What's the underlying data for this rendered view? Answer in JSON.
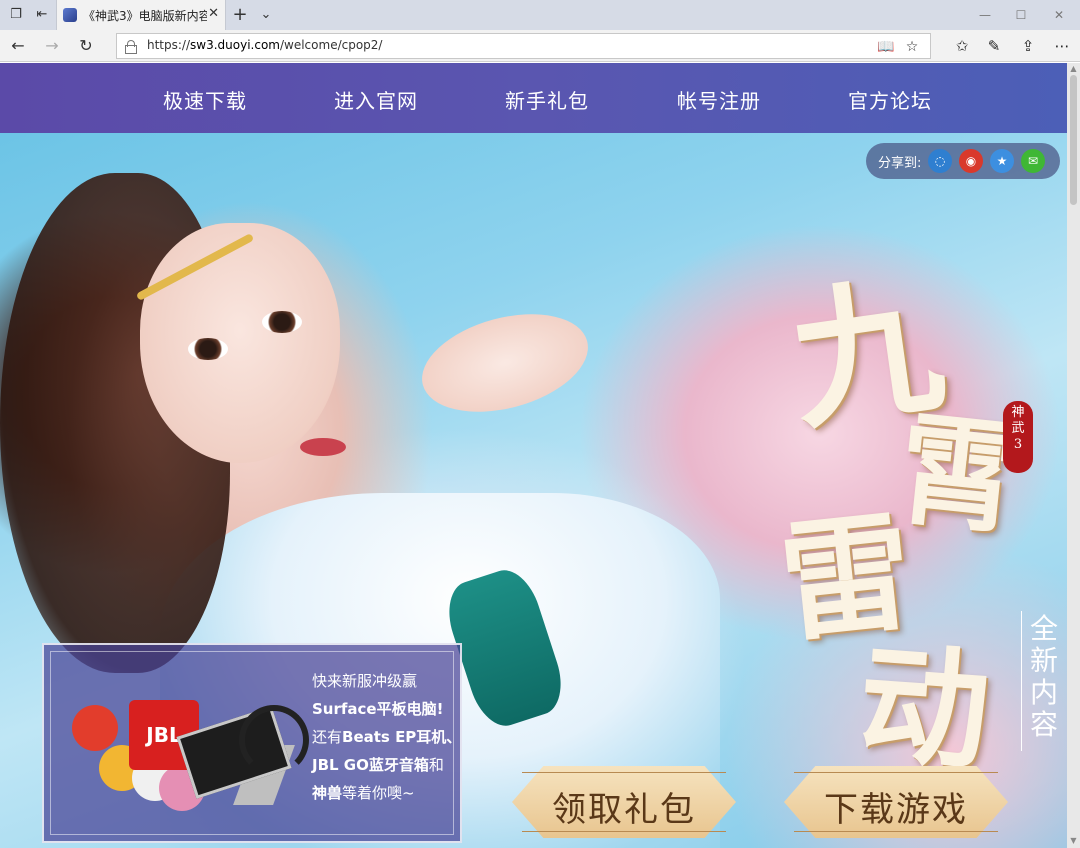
{
  "browser": {
    "tab_title": "《神武3》电脑版新内容",
    "url_prefix": "https://",
    "url_domain": "sw3.duoyi.com",
    "url_path": "/welcome/cpop2/"
  },
  "nav": {
    "items": [
      {
        "label": "极速下载"
      },
      {
        "label": "进入官网"
      },
      {
        "label": "新手礼包"
      },
      {
        "label": "帐号注册"
      },
      {
        "label": "官方论坛"
      }
    ]
  },
  "share": {
    "label": "分享到:",
    "targets": [
      {
        "icon": "qq-zone-icon",
        "color": "#2f7fd0"
      },
      {
        "icon": "weibo-icon",
        "color": "#d9392b"
      },
      {
        "icon": "favorite-star-icon",
        "color": "#3d8fe0"
      },
      {
        "icon": "wechat-icon",
        "color": "#3fb735"
      }
    ]
  },
  "hero": {
    "title_chars": [
      "九",
      "霄",
      "雷",
      "动"
    ],
    "seal_text": "神武3",
    "subtitle": "全新内容"
  },
  "promo": {
    "line1": "快来新服冲级赢",
    "line2": "Surface平板电脑!",
    "line3_a": "还有",
    "line3_b": "Beats EP耳机、",
    "line4_a": "JBL GO蓝牙音箱",
    "line4_b": "和",
    "line5_a": "神兽",
    "line5_b": "等着你噢~",
    "jbl_label": "JBL"
  },
  "cta": {
    "gift": "领取礼包",
    "download": "下载游戏"
  }
}
